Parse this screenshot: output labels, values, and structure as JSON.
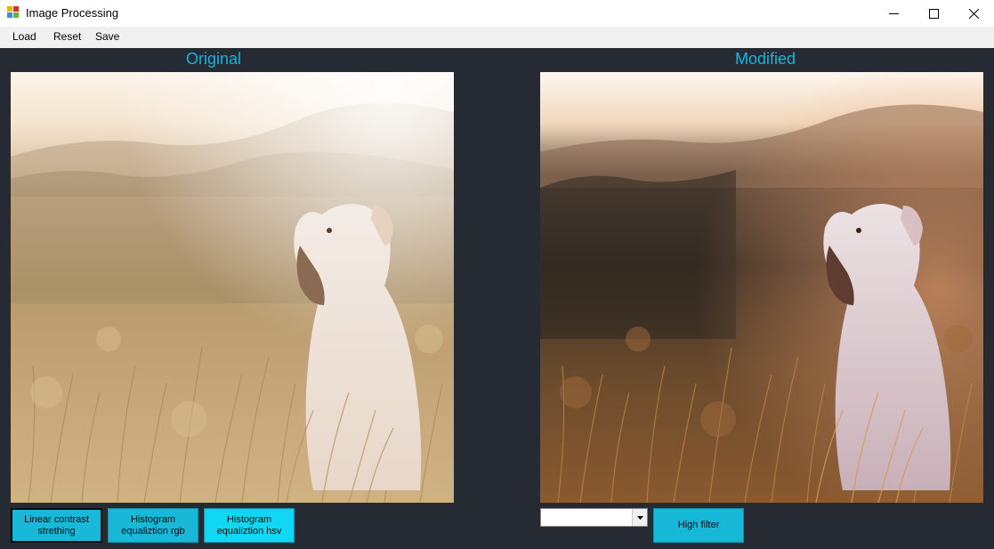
{
  "window": {
    "title": "Image Processing",
    "controls": {
      "minimize_icon": "minimize-icon",
      "maximize_icon": "maximize-icon",
      "close_icon": "close-icon"
    }
  },
  "menu": {
    "items": [
      "Load",
      "Reset",
      "Save"
    ]
  },
  "panels": {
    "original": {
      "title": "Original",
      "image_alt": "Dog sitting in grass field at sunset"
    },
    "modified": {
      "title": "Modified",
      "image_alt": "Dog sitting in grass field at sunset (processed)"
    }
  },
  "actions": {
    "linear_contrast": "Linear contrast strething",
    "hist_rgb": "Histogram equaliztion rgb",
    "hist_hsv": "Histogram equaliztion hsv",
    "filter_select_value": "",
    "high_filter": "High filter"
  },
  "colors": {
    "background": "#262a33",
    "accent_title": "#17b4dc",
    "button": "#17b8d8"
  }
}
